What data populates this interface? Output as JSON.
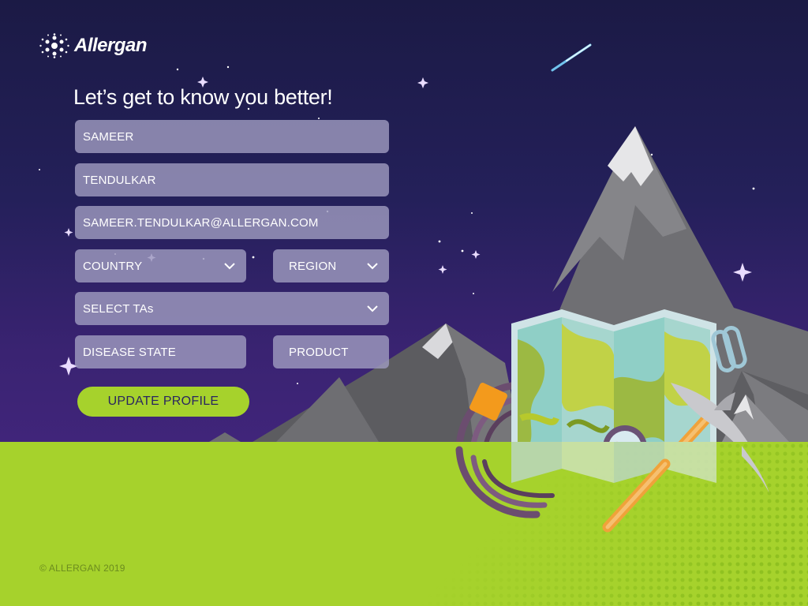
{
  "brand": {
    "logo_text": "Allergan",
    "logo_icon": "allergan-dots-icon"
  },
  "headline": "Let’s get to know you better!",
  "form": {
    "first_name": {
      "value": "SAMEER"
    },
    "last_name": {
      "value": "TENDULKAR"
    },
    "email": {
      "value": "SAMEER.TENDULKAR@ALLERGAN.COM"
    },
    "country": {
      "label": "COUNTRY",
      "icon": "chevron-down-icon"
    },
    "region": {
      "label": "REGION",
      "icon": "chevron-down-icon"
    },
    "therapeutic_areas": {
      "label": "SELECT TAs",
      "icon": "chevron-down-icon"
    },
    "disease_state": {
      "label": "DISEASE STATE"
    },
    "product": {
      "label": "PRODUCT"
    },
    "submit_label": "UPDATE PROFILE"
  },
  "footer": {
    "copyright": "© ALLERGAN 2019"
  },
  "colors": {
    "sky_top": "#1b1a45",
    "sky_bottom": "#40257a",
    "ground": "#a6d22c",
    "field_bg": "#9e9abe",
    "button_bg": "#a6d22c",
    "button_text": "#2a2560"
  },
  "illustration": {
    "icons": [
      "mountain-icon",
      "snow-peak-icon",
      "map-icon",
      "compass-icon",
      "ice-axe-icon",
      "rope-icon",
      "carabiner-icon",
      "shooting-star-icon",
      "star-icon"
    ]
  }
}
